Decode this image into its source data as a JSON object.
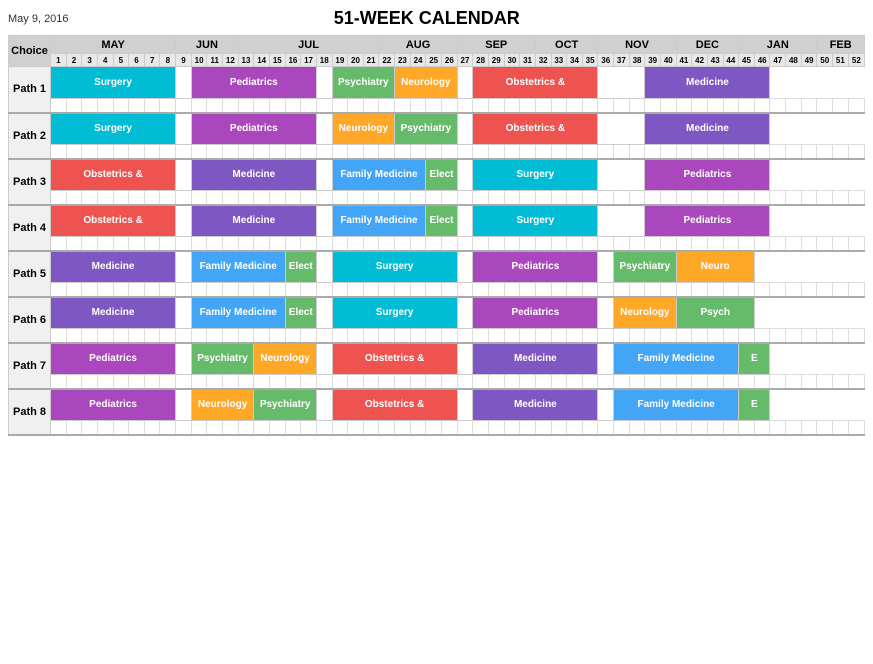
{
  "title": "51-WEEK CALENDAR",
  "date": "May 9, 2016",
  "months": [
    "MAY",
    "JUN",
    "JUL",
    "AUG",
    "SEP",
    "OCT",
    "NOV",
    "DEC",
    "JAN",
    "FEB"
  ],
  "paths": [
    {
      "label": "Path 1",
      "rotations": [
        {
          "label": "Surgery",
          "class": "rot-surgery",
          "start": 1,
          "span": 8
        },
        {
          "label": "",
          "class": "rot-empty",
          "start": 9,
          "span": 1
        },
        {
          "label": "Pediatrics",
          "class": "rot-pediatrics",
          "start": 10,
          "span": 8
        },
        {
          "label": "",
          "class": "rot-empty",
          "start": 18,
          "span": 1
        },
        {
          "label": "Psychiatry",
          "class": "rot-psychiatry",
          "start": 19,
          "span": 4
        },
        {
          "label": "Neurology",
          "class": "rot-neurology",
          "start": 23,
          "span": 4
        },
        {
          "label": "",
          "class": "rot-empty",
          "start": 27,
          "span": 1
        },
        {
          "label": "Obstetrics &",
          "class": "rot-obstetrics",
          "start": 28,
          "span": 8
        },
        {
          "label": "",
          "class": "rot-empty",
          "start": 36,
          "span": 3
        },
        {
          "label": "Medicine",
          "class": "rot-medicine",
          "start": 39,
          "span": 8
        }
      ]
    },
    {
      "label": "Path 2",
      "rotations": [
        {
          "label": "Surgery",
          "class": "rot-surgery",
          "start": 1,
          "span": 8
        },
        {
          "label": "",
          "class": "rot-empty",
          "start": 9,
          "span": 1
        },
        {
          "label": "Pediatrics",
          "class": "rot-pediatrics",
          "start": 10,
          "span": 8
        },
        {
          "label": "",
          "class": "rot-empty",
          "start": 18,
          "span": 1
        },
        {
          "label": "Neurology",
          "class": "rot-neurology",
          "start": 19,
          "span": 4
        },
        {
          "label": "Psychiatry",
          "class": "rot-psychiatry",
          "start": 23,
          "span": 4
        },
        {
          "label": "",
          "class": "rot-empty",
          "start": 27,
          "span": 1
        },
        {
          "label": "Obstetrics &",
          "class": "rot-obstetrics",
          "start": 28,
          "span": 8
        },
        {
          "label": "",
          "class": "rot-empty",
          "start": 36,
          "span": 3
        },
        {
          "label": "Medicine",
          "class": "rot-medicine",
          "start": 39,
          "span": 8
        }
      ]
    },
    {
      "label": "Path 3",
      "rotations": [
        {
          "label": "Obstetrics &",
          "class": "rot-obstetrics",
          "start": 1,
          "span": 8
        },
        {
          "label": "",
          "class": "rot-empty",
          "start": 9,
          "span": 1
        },
        {
          "label": "Medicine",
          "class": "rot-medicine",
          "start": 10,
          "span": 8
        },
        {
          "label": "",
          "class": "rot-empty",
          "start": 18,
          "span": 1
        },
        {
          "label": "Family Medicine",
          "class": "rot-family",
          "start": 19,
          "span": 6
        },
        {
          "label": "Elect",
          "class": "rot-elective",
          "start": 25,
          "span": 2
        },
        {
          "label": "",
          "class": "rot-empty",
          "start": 27,
          "span": 1
        },
        {
          "label": "Surgery",
          "class": "rot-surgery",
          "start": 28,
          "span": 8
        },
        {
          "label": "",
          "class": "rot-empty",
          "start": 36,
          "span": 3
        },
        {
          "label": "Pediatrics",
          "class": "rot-pediatrics",
          "start": 39,
          "span": 8
        }
      ]
    },
    {
      "label": "Path 4",
      "rotations": [
        {
          "label": "Obstetrics &",
          "class": "rot-obstetrics",
          "start": 1,
          "span": 8
        },
        {
          "label": "",
          "class": "rot-empty",
          "start": 9,
          "span": 1
        },
        {
          "label": "Medicine",
          "class": "rot-medicine",
          "start": 10,
          "span": 8
        },
        {
          "label": "",
          "class": "rot-empty",
          "start": 18,
          "span": 1
        },
        {
          "label": "Family Medicine",
          "class": "rot-family",
          "start": 19,
          "span": 6
        },
        {
          "label": "Elect",
          "class": "rot-elective",
          "start": 25,
          "span": 2
        },
        {
          "label": "",
          "class": "rot-empty",
          "start": 27,
          "span": 1
        },
        {
          "label": "Surgery",
          "class": "rot-surgery",
          "start": 28,
          "span": 8
        },
        {
          "label": "",
          "class": "rot-empty",
          "start": 36,
          "span": 3
        },
        {
          "label": "Pediatrics",
          "class": "rot-pediatrics",
          "start": 39,
          "span": 8
        }
      ]
    },
    {
      "label": "Path 5",
      "rotations": [
        {
          "label": "Medicine",
          "class": "rot-medicine",
          "start": 1,
          "span": 8
        },
        {
          "label": "",
          "class": "rot-empty",
          "start": 9,
          "span": 1
        },
        {
          "label": "Family Medicine",
          "class": "rot-family",
          "start": 10,
          "span": 6
        },
        {
          "label": "Elect",
          "class": "rot-elective",
          "start": 16,
          "span": 2
        },
        {
          "label": "",
          "class": "rot-empty",
          "start": 18,
          "span": 1
        },
        {
          "label": "Surgery",
          "class": "rot-surgery",
          "start": 19,
          "span": 8
        },
        {
          "label": "",
          "class": "rot-empty",
          "start": 27,
          "span": 1
        },
        {
          "label": "Pediatrics",
          "class": "rot-pediatrics",
          "start": 28,
          "span": 8
        },
        {
          "label": "",
          "class": "rot-empty",
          "start": 36,
          "span": 1
        },
        {
          "label": "Psychiatry",
          "class": "rot-psychiatry",
          "start": 37,
          "span": 4
        },
        {
          "label": "Neuro",
          "class": "rot-neurology",
          "start": 41,
          "span": 5
        }
      ]
    },
    {
      "label": "Path 6",
      "rotations": [
        {
          "label": "Medicine",
          "class": "rot-medicine",
          "start": 1,
          "span": 8
        },
        {
          "label": "",
          "class": "rot-empty",
          "start": 9,
          "span": 1
        },
        {
          "label": "Family Medicine",
          "class": "rot-family",
          "start": 10,
          "span": 6
        },
        {
          "label": "Elect",
          "class": "rot-elective",
          "start": 16,
          "span": 2
        },
        {
          "label": "",
          "class": "rot-empty",
          "start": 18,
          "span": 1
        },
        {
          "label": "Surgery",
          "class": "rot-surgery",
          "start": 19,
          "span": 8
        },
        {
          "label": "",
          "class": "rot-empty",
          "start": 27,
          "span": 1
        },
        {
          "label": "Pediatrics",
          "class": "rot-pediatrics",
          "start": 28,
          "span": 8
        },
        {
          "label": "",
          "class": "rot-empty",
          "start": 36,
          "span": 1
        },
        {
          "label": "Neurology",
          "class": "rot-neurology",
          "start": 37,
          "span": 4
        },
        {
          "label": "Psych",
          "class": "rot-psychiatry",
          "start": 41,
          "span": 5
        }
      ]
    },
    {
      "label": "Path 7",
      "rotations": [
        {
          "label": "Pediatrics",
          "class": "rot-pediatrics",
          "start": 1,
          "span": 8
        },
        {
          "label": "",
          "class": "rot-empty",
          "start": 9,
          "span": 1
        },
        {
          "label": "Psychiatry",
          "class": "rot-psychiatry",
          "start": 10,
          "span": 4
        },
        {
          "label": "Neurology",
          "class": "rot-neurology",
          "start": 14,
          "span": 4
        },
        {
          "label": "",
          "class": "rot-empty",
          "start": 18,
          "span": 1
        },
        {
          "label": "Obstetrics &",
          "class": "rot-obstetrics",
          "start": 19,
          "span": 8
        },
        {
          "label": "",
          "class": "rot-empty",
          "start": 27,
          "span": 1
        },
        {
          "label": "Medicine",
          "class": "rot-medicine",
          "start": 28,
          "span": 8
        },
        {
          "label": "",
          "class": "rot-empty",
          "start": 36,
          "span": 1
        },
        {
          "label": "Family Medicine",
          "class": "rot-family",
          "start": 37,
          "span": 8
        },
        {
          "label": "E",
          "class": "rot-elective",
          "start": 45,
          "span": 2
        }
      ]
    },
    {
      "label": "Path 8",
      "rotations": [
        {
          "label": "Pediatrics",
          "class": "rot-pediatrics",
          "start": 1,
          "span": 8
        },
        {
          "label": "",
          "class": "rot-empty",
          "start": 9,
          "span": 1
        },
        {
          "label": "Neurology",
          "class": "rot-neurology",
          "start": 10,
          "span": 4
        },
        {
          "label": "Psychiatry",
          "class": "rot-psychiatry",
          "start": 14,
          "span": 4
        },
        {
          "label": "",
          "class": "rot-empty",
          "start": 18,
          "span": 1
        },
        {
          "label": "Obstetrics &",
          "class": "rot-obstetrics",
          "start": 19,
          "span": 8
        },
        {
          "label": "",
          "class": "rot-empty",
          "start": 27,
          "span": 1
        },
        {
          "label": "Medicine",
          "class": "rot-medicine",
          "start": 28,
          "span": 8
        },
        {
          "label": "",
          "class": "rot-empty",
          "start": 36,
          "span": 1
        },
        {
          "label": "Family Medicine",
          "class": "rot-family",
          "start": 37,
          "span": 8
        },
        {
          "label": "E",
          "class": "rot-elective",
          "start": 45,
          "span": 2
        }
      ]
    }
  ],
  "week_numbers": [
    1,
    2,
    3,
    4,
    5,
    6,
    7,
    8,
    9,
    10,
    11,
    12,
    13,
    14,
    15,
    16,
    17,
    18,
    19,
    20,
    21,
    22,
    23,
    24,
    25,
    26,
    27,
    28,
    29,
    30,
    31,
    32,
    33,
    34,
    35,
    36,
    37,
    38,
    39,
    40,
    41,
    42,
    43,
    44,
    45
  ]
}
